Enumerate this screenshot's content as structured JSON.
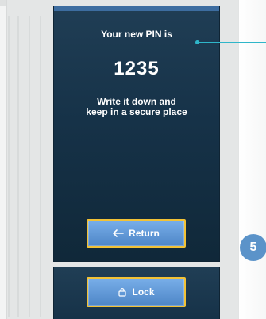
{
  "screen": {
    "title": "Your new PIN is",
    "pin": "1235",
    "note": "Write it down and keep in a secure place",
    "return_label": "Return",
    "lock_label": "Lock"
  },
  "step": {
    "number": "5"
  },
  "icons": {
    "return": "arrow-left-icon",
    "lock": "lock-icon"
  },
  "colors": {
    "screen_bg": "#163248",
    "button": "#5f97d6",
    "button_border": "#f2c236",
    "callout": "#2fb6c9",
    "badge": "#5b93c9"
  }
}
